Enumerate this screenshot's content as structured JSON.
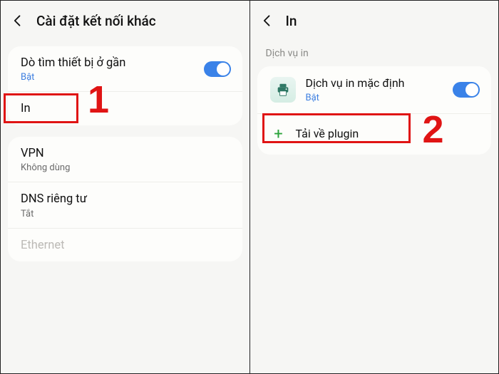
{
  "left": {
    "title": "Cài đặt kết nối khác",
    "items": [
      {
        "title": "Dò tìm thiết bị ở gần",
        "sub": "Bật",
        "sub_on": true,
        "toggle": true
      },
      {
        "title": "In"
      },
      {
        "title": "VPN",
        "sub": "Không dùng"
      },
      {
        "title": "DNS riêng tư",
        "sub": "Tắt"
      },
      {
        "title": "Ethernet",
        "disabled": true
      }
    ]
  },
  "right": {
    "title": "In",
    "section_label": "Dịch vụ in",
    "service": {
      "title": "Dịch vụ in mặc định",
      "sub": "Bật",
      "toggle": true
    },
    "download": "Tải về plugin"
  },
  "annotations": {
    "step1": "1",
    "step2": "2"
  }
}
